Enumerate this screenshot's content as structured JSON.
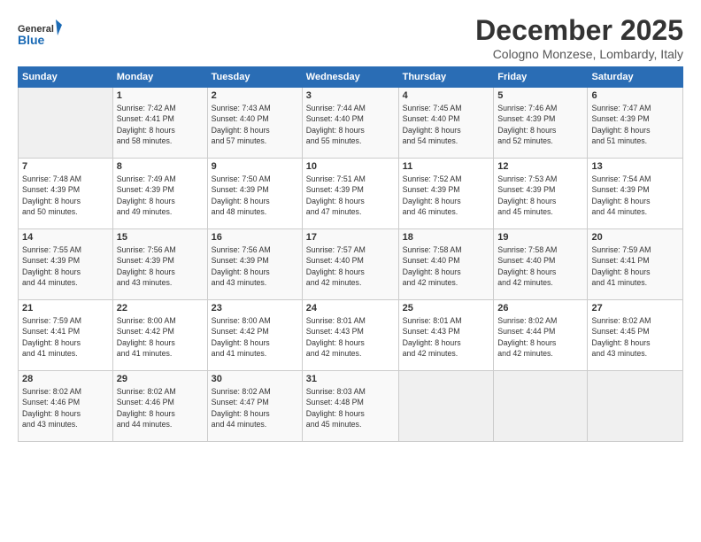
{
  "logo": {
    "line1": "General",
    "line2": "Blue"
  },
  "title": "December 2025",
  "location": "Cologno Monzese, Lombardy, Italy",
  "days_header": [
    "Sunday",
    "Monday",
    "Tuesday",
    "Wednesday",
    "Thursday",
    "Friday",
    "Saturday"
  ],
  "weeks": [
    [
      {
        "num": "",
        "info": ""
      },
      {
        "num": "1",
        "info": "Sunrise: 7:42 AM\nSunset: 4:41 PM\nDaylight: 8 hours\nand 58 minutes."
      },
      {
        "num": "2",
        "info": "Sunrise: 7:43 AM\nSunset: 4:40 PM\nDaylight: 8 hours\nand 57 minutes."
      },
      {
        "num": "3",
        "info": "Sunrise: 7:44 AM\nSunset: 4:40 PM\nDaylight: 8 hours\nand 55 minutes."
      },
      {
        "num": "4",
        "info": "Sunrise: 7:45 AM\nSunset: 4:40 PM\nDaylight: 8 hours\nand 54 minutes."
      },
      {
        "num": "5",
        "info": "Sunrise: 7:46 AM\nSunset: 4:39 PM\nDaylight: 8 hours\nand 52 minutes."
      },
      {
        "num": "6",
        "info": "Sunrise: 7:47 AM\nSunset: 4:39 PM\nDaylight: 8 hours\nand 51 minutes."
      }
    ],
    [
      {
        "num": "7",
        "info": "Sunrise: 7:48 AM\nSunset: 4:39 PM\nDaylight: 8 hours\nand 50 minutes."
      },
      {
        "num": "8",
        "info": "Sunrise: 7:49 AM\nSunset: 4:39 PM\nDaylight: 8 hours\nand 49 minutes."
      },
      {
        "num": "9",
        "info": "Sunrise: 7:50 AM\nSunset: 4:39 PM\nDaylight: 8 hours\nand 48 minutes."
      },
      {
        "num": "10",
        "info": "Sunrise: 7:51 AM\nSunset: 4:39 PM\nDaylight: 8 hours\nand 47 minutes."
      },
      {
        "num": "11",
        "info": "Sunrise: 7:52 AM\nSunset: 4:39 PM\nDaylight: 8 hours\nand 46 minutes."
      },
      {
        "num": "12",
        "info": "Sunrise: 7:53 AM\nSunset: 4:39 PM\nDaylight: 8 hours\nand 45 minutes."
      },
      {
        "num": "13",
        "info": "Sunrise: 7:54 AM\nSunset: 4:39 PM\nDaylight: 8 hours\nand 44 minutes."
      }
    ],
    [
      {
        "num": "14",
        "info": "Sunrise: 7:55 AM\nSunset: 4:39 PM\nDaylight: 8 hours\nand 44 minutes."
      },
      {
        "num": "15",
        "info": "Sunrise: 7:56 AM\nSunset: 4:39 PM\nDaylight: 8 hours\nand 43 minutes."
      },
      {
        "num": "16",
        "info": "Sunrise: 7:56 AM\nSunset: 4:39 PM\nDaylight: 8 hours\nand 43 minutes."
      },
      {
        "num": "17",
        "info": "Sunrise: 7:57 AM\nSunset: 4:40 PM\nDaylight: 8 hours\nand 42 minutes."
      },
      {
        "num": "18",
        "info": "Sunrise: 7:58 AM\nSunset: 4:40 PM\nDaylight: 8 hours\nand 42 minutes."
      },
      {
        "num": "19",
        "info": "Sunrise: 7:58 AM\nSunset: 4:40 PM\nDaylight: 8 hours\nand 42 minutes."
      },
      {
        "num": "20",
        "info": "Sunrise: 7:59 AM\nSunset: 4:41 PM\nDaylight: 8 hours\nand 41 minutes."
      }
    ],
    [
      {
        "num": "21",
        "info": "Sunrise: 7:59 AM\nSunset: 4:41 PM\nDaylight: 8 hours\nand 41 minutes."
      },
      {
        "num": "22",
        "info": "Sunrise: 8:00 AM\nSunset: 4:42 PM\nDaylight: 8 hours\nand 41 minutes."
      },
      {
        "num": "23",
        "info": "Sunrise: 8:00 AM\nSunset: 4:42 PM\nDaylight: 8 hours\nand 41 minutes."
      },
      {
        "num": "24",
        "info": "Sunrise: 8:01 AM\nSunset: 4:43 PM\nDaylight: 8 hours\nand 42 minutes."
      },
      {
        "num": "25",
        "info": "Sunrise: 8:01 AM\nSunset: 4:43 PM\nDaylight: 8 hours\nand 42 minutes."
      },
      {
        "num": "26",
        "info": "Sunrise: 8:02 AM\nSunset: 4:44 PM\nDaylight: 8 hours\nand 42 minutes."
      },
      {
        "num": "27",
        "info": "Sunrise: 8:02 AM\nSunset: 4:45 PM\nDaylight: 8 hours\nand 43 minutes."
      }
    ],
    [
      {
        "num": "28",
        "info": "Sunrise: 8:02 AM\nSunset: 4:46 PM\nDaylight: 8 hours\nand 43 minutes."
      },
      {
        "num": "29",
        "info": "Sunrise: 8:02 AM\nSunset: 4:46 PM\nDaylight: 8 hours\nand 44 minutes."
      },
      {
        "num": "30",
        "info": "Sunrise: 8:02 AM\nSunset: 4:47 PM\nDaylight: 8 hours\nand 44 minutes."
      },
      {
        "num": "31",
        "info": "Sunrise: 8:03 AM\nSunset: 4:48 PM\nDaylight: 8 hours\nand 45 minutes."
      },
      {
        "num": "",
        "info": ""
      },
      {
        "num": "",
        "info": ""
      },
      {
        "num": "",
        "info": ""
      }
    ]
  ]
}
